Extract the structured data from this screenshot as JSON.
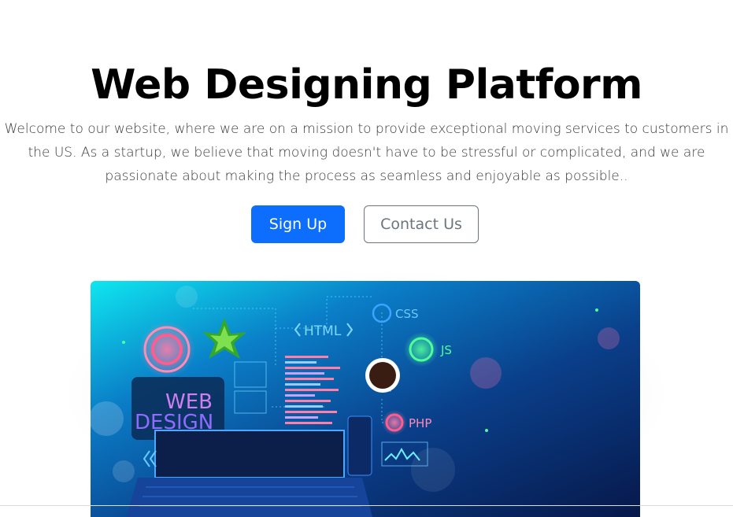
{
  "hero": {
    "title": "Web Designing Platform",
    "lead": "Welcome to our website, where we are on a mission to provide exceptional moving services to customers in the US. As a startup, we believe that moving doesn't have to be stressful or complicated, and we are passionate about making the process as seamless and enjoyable as possible..",
    "primary_button": "Sign Up",
    "secondary_button": "Contact Us"
  },
  "illustration": {
    "labels": {
      "html": "HTML",
      "css": "CSS",
      "js": "JS",
      "php": "PHP",
      "web": "WEB",
      "design": "DESIGN"
    }
  },
  "colors": {
    "primary": "#0d6efd",
    "secondary": "#6c757d",
    "text": "#000000"
  }
}
